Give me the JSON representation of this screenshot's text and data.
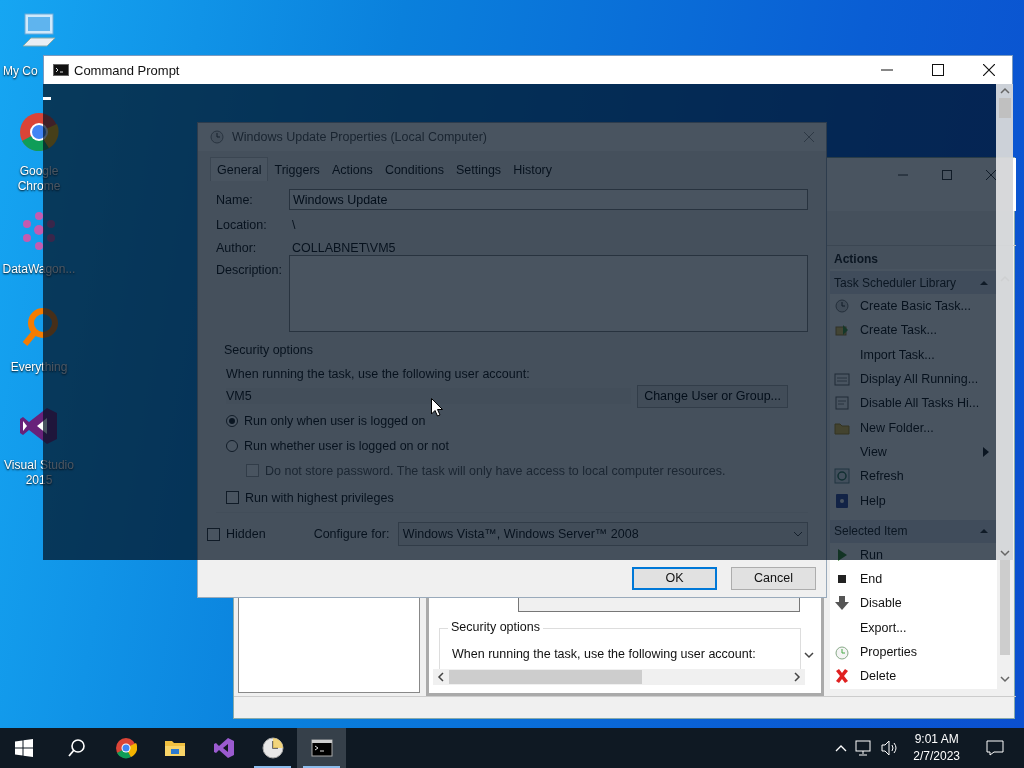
{
  "desktop_icons": [
    {
      "label": "My Co",
      "kind": "computer"
    },
    {
      "label": "Google Chrome",
      "kind": "chrome"
    },
    {
      "label": "DataWagon...",
      "kind": "datawagon"
    },
    {
      "label": "Everything",
      "kind": "search"
    },
    {
      "label": "Visual Studio 2015",
      "kind": "vs"
    }
  ],
  "task_scheduler": {
    "actions_title": "Actions",
    "sections": [
      {
        "title": "Task Scheduler Library",
        "items": [
          {
            "label": "Create Basic Task...",
            "kind": "wizard",
            "submenu": false
          },
          {
            "label": "Create Task...",
            "kind": "task",
            "submenu": false
          },
          {
            "label": "Import Task...",
            "kind": "plain",
            "submenu": false
          },
          {
            "label": "Display All Running...",
            "kind": "running",
            "submenu": false
          },
          {
            "label": "Disable All Tasks Hi...",
            "kind": "disable_all",
            "submenu": false
          },
          {
            "label": "New Folder...",
            "kind": "folder",
            "submenu": false
          },
          {
            "label": "View",
            "kind": "plain",
            "submenu": true
          },
          {
            "label": "Refresh",
            "kind": "refresh",
            "submenu": false
          },
          {
            "label": "Help",
            "kind": "help",
            "submenu": false
          }
        ]
      },
      {
        "title": "Selected Item",
        "items": [
          {
            "label": "Run",
            "kind": "run",
            "submenu": false
          },
          {
            "label": "End",
            "kind": "end",
            "submenu": false
          },
          {
            "label": "Disable",
            "kind": "disable",
            "submenu": false
          },
          {
            "label": "Export...",
            "kind": "plain",
            "submenu": false
          },
          {
            "label": "Properties",
            "kind": "properties",
            "submenu": false
          },
          {
            "label": "Delete",
            "kind": "delete",
            "submenu": false
          }
        ]
      }
    ],
    "security_title": "Security options",
    "account_prompt": "When running the task, use the following user account:"
  },
  "properties_dialog": {
    "title": "Windows Update Properties (Local Computer)",
    "tabs": [
      {
        "label": "General",
        "selected": true
      },
      {
        "label": "Triggers",
        "selected": false
      },
      {
        "label": "Actions",
        "selected": false
      },
      {
        "label": "Conditions",
        "selected": false
      },
      {
        "label": "Settings",
        "selected": false
      },
      {
        "label": "History",
        "selected": false
      }
    ],
    "name_label": "Name:",
    "name_value": "Windows Update",
    "location_label": "Location:",
    "location_value": "\\",
    "author_label": "Author:",
    "author_value": "COLLABNET\\VM5",
    "description_label": "Description:",
    "security": {
      "title": "Security options",
      "account_prompt": "When running the task, use the following user account:",
      "account": "VM5",
      "change_button": "Change User or Group...",
      "options": [
        {
          "label": "Run only when user is logged on",
          "selected": true
        },
        {
          "label": "Run whether user is logged on or not",
          "selected": false
        }
      ],
      "no_password": {
        "label": "Do not store password.  The task will only have access to local computer resources.",
        "checked": false,
        "disabled": true
      },
      "highest": {
        "label": "Run with highest privileges",
        "checked": false
      }
    },
    "hidden": {
      "label": "Hidden",
      "checked": false
    },
    "configure_label": "Configure for:",
    "configure_value": "Windows Vista™, Windows Server™ 2008",
    "buttons": [
      {
        "label": "OK",
        "default": true
      },
      {
        "label": "Cancel",
        "default": false
      }
    ]
  },
  "command_prompt": {
    "title": "Command Prompt"
  },
  "taskbar": {
    "apps": [
      {
        "kind": "search",
        "running": false,
        "active": false
      },
      {
        "kind": "chrome",
        "running": false,
        "active": false
      },
      {
        "kind": "explorer",
        "running": false,
        "active": false
      },
      {
        "kind": "vs",
        "running": false,
        "active": false
      },
      {
        "kind": "scheduler",
        "running": true,
        "active": false
      },
      {
        "kind": "cmd",
        "running": true,
        "active": true
      }
    ],
    "time": "9:01 AM",
    "date": "2/7/2023"
  }
}
